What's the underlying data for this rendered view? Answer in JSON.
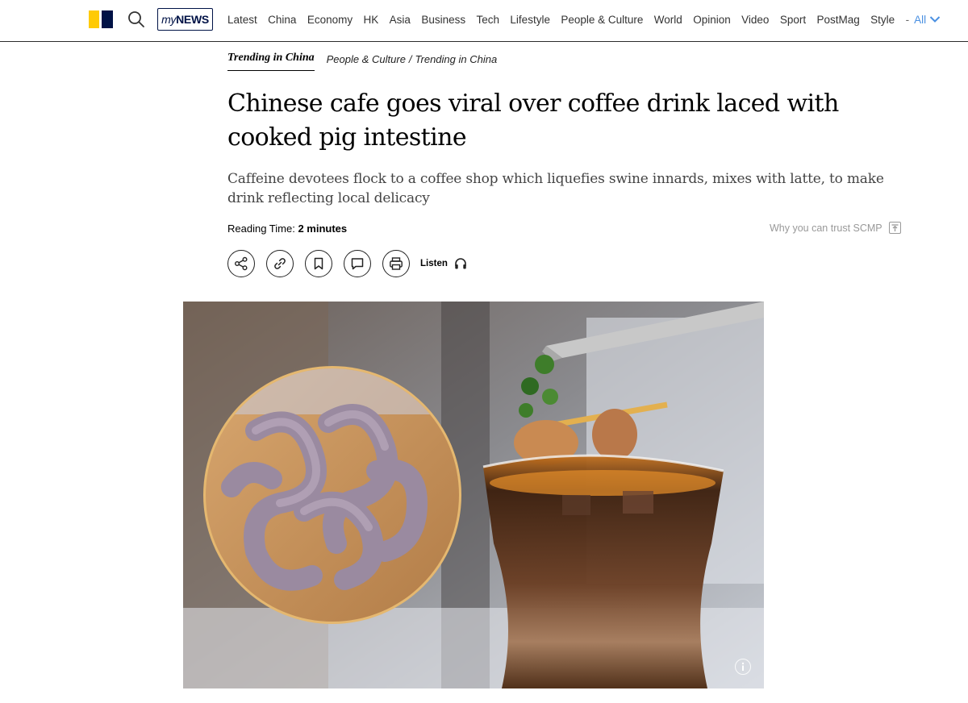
{
  "nav": {
    "mynews_prefix": "my",
    "mynews_label": "NEWS",
    "items": [
      "Latest",
      "China",
      "Economy",
      "HK",
      "Asia",
      "Business",
      "Tech",
      "Lifestyle",
      "People & Culture",
      "World",
      "Opinion",
      "Video",
      "Sport",
      "PostMag",
      "Style"
    ],
    "separator": "-",
    "all_label": "All"
  },
  "breadcrumb": {
    "topic": "Trending in China",
    "section": "People & Culture",
    "separator": "/",
    "subsection": "Trending in China"
  },
  "article": {
    "headline": "Chinese cafe goes viral over coffee drink laced with cooked pig intestine",
    "subheadline": "Caffeine devotees flock to a coffee shop which liquefies swine innards, mixes with latte, to make drink reflecting local delicacy",
    "reading_time_label": "Reading Time:",
    "reading_time_value": "2 minutes",
    "trust_label": "Why you can trust SCMP"
  },
  "actions": {
    "listen_label": "Listen",
    "icons": [
      "share-icon",
      "link-icon",
      "bookmark-icon",
      "comment-icon",
      "print-icon",
      "headphones-icon"
    ]
  },
  "colors": {
    "brand_yellow": "#ffca05",
    "brand_navy": "#001246",
    "nav_accent": "#4a90e2"
  }
}
